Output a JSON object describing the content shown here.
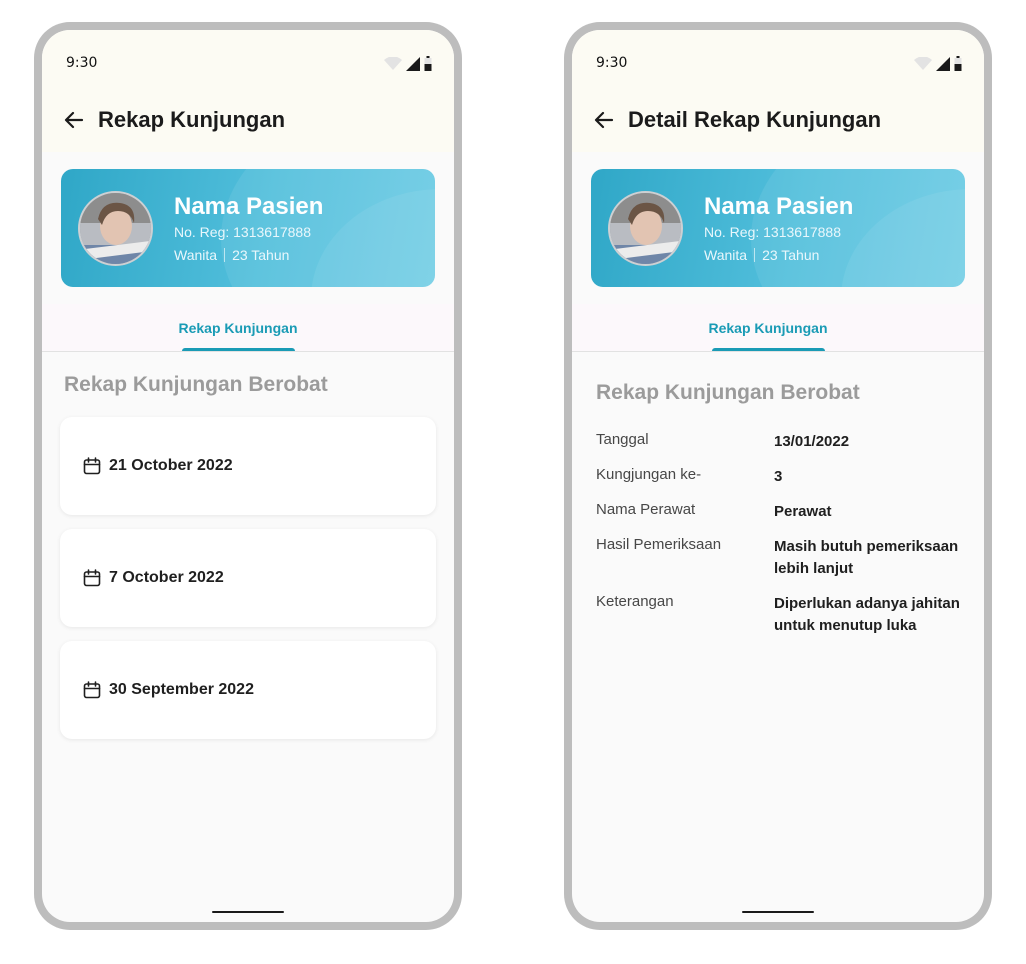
{
  "status": {
    "time": "9:30"
  },
  "patient": {
    "name": "Nama Pasien",
    "reg": "No. Reg: 1313617888",
    "gender": "Wanita",
    "age": "23 Tahun"
  },
  "left_screen": {
    "title": "Rekap Kunjungan",
    "tab_label": "Rekap Kunjungan",
    "section_title": "Rekap Kunjungan Berobat",
    "visits": [
      {
        "date": "21 October 2022"
      },
      {
        "date": "7 October 2022"
      },
      {
        "date": "30 September 2022"
      }
    ]
  },
  "right_screen": {
    "title": "Detail Rekap Kunjungan",
    "tab_label": "Rekap Kunjungan",
    "section_title": "Rekap Kunjungan Berobat",
    "details": [
      {
        "label": "Tanggal",
        "value": "13/01/2022"
      },
      {
        "label": "Kungjungan ke-",
        "value": "3"
      },
      {
        "label": "Nama Perawat",
        "value": "Perawat"
      },
      {
        "label": "Hasil Pemeriksaan",
        "value": "Masih butuh pemeriksaan lebih lanjut"
      },
      {
        "label": "Keterangan",
        "value": "Diperlukan adanya jahitan untuk menutup luka"
      }
    ]
  },
  "icons": {
    "back": "arrow-left-icon",
    "calendar": "calendar-icon",
    "wifi": "wifi-icon",
    "signal": "signal-icon",
    "battery": "battery-icon"
  },
  "colors": {
    "accent": "#1a9bb5",
    "card_gradient_start": "#2fa7c7",
    "card_gradient_end": "#6ccbe4",
    "appbar_bg": "#fcfbf3",
    "section_title": "#9b9b9b"
  }
}
